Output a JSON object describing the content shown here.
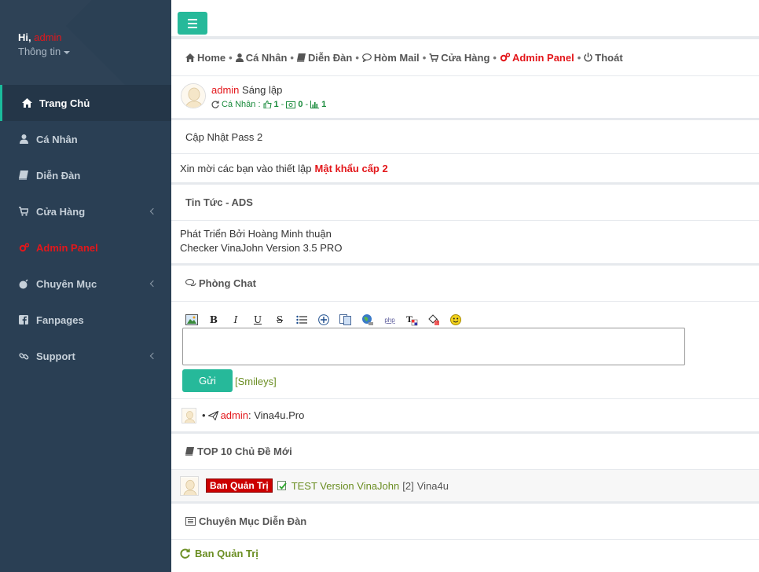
{
  "user": {
    "greeting": "Hi,",
    "name": "admin",
    "info_label": "Thông tin"
  },
  "sidebar": {
    "items": [
      {
        "label": "Trang Chủ",
        "icon": "home-icon"
      },
      {
        "label": "Cá Nhân",
        "icon": "user-icon"
      },
      {
        "label": "Diễn Đàn",
        "icon": "book-icon"
      },
      {
        "label": "Cửa Hàng",
        "icon": "cart-icon"
      },
      {
        "label": "Admin Panel",
        "icon": "cogs-icon"
      },
      {
        "label": "Chuyên Mục",
        "icon": "bomb-icon"
      },
      {
        "label": "Fanpages",
        "icon": "facebook-icon"
      },
      {
        "label": "Support",
        "icon": "chain-icon"
      }
    ]
  },
  "nav": {
    "home": "Home",
    "profile": "Cá Nhân",
    "forum": "Diễn Đàn",
    "mail": "Hòm Mail",
    "shop": "Cửa Hàng",
    "admin": "Admin Panel",
    "logout": "Thoát",
    "sep": "•"
  },
  "profile": {
    "name": "admin",
    "role": "Sáng lập",
    "stats_label": "Cá Nhân :",
    "likes": "1",
    "dash1": "-",
    "money": "0",
    "dash2": "-",
    "posts": "1"
  },
  "update_pass": "Cập Nhật Pass 2",
  "invite": {
    "text": "Xin mời các bạn vào thiết lập",
    "link": "Mật khẩu cấp 2"
  },
  "news": {
    "title": "Tin Tức - ADS",
    "line1": "Phát Triển Bởi Hoàng Minh thuận",
    "line2": "Checker VinaJohn Version 3.5 PRO"
  },
  "chat": {
    "title": "Phòng Chat",
    "send": "Gửi",
    "smileys": "[Smileys]",
    "message": {
      "bullet": "•",
      "user": "admin",
      "text": ": Vina4u.Pro"
    }
  },
  "top10": {
    "title": "TOP 10 Chủ Đề Mới",
    "item": {
      "badge": "Ban Quản Trị",
      "title": "TEST Version VinaJohn",
      "count": "[2]",
      "author": "Vina4u"
    }
  },
  "categories": {
    "title": "Chuyên Mục Diễn Đàn",
    "first": "Ban Quản Trị"
  },
  "colors": {
    "accent": "#26b99a",
    "sidebar": "#2a3f54",
    "red": "#e3171b",
    "green": "#1a8b3c",
    "olive": "#6b8e23"
  }
}
